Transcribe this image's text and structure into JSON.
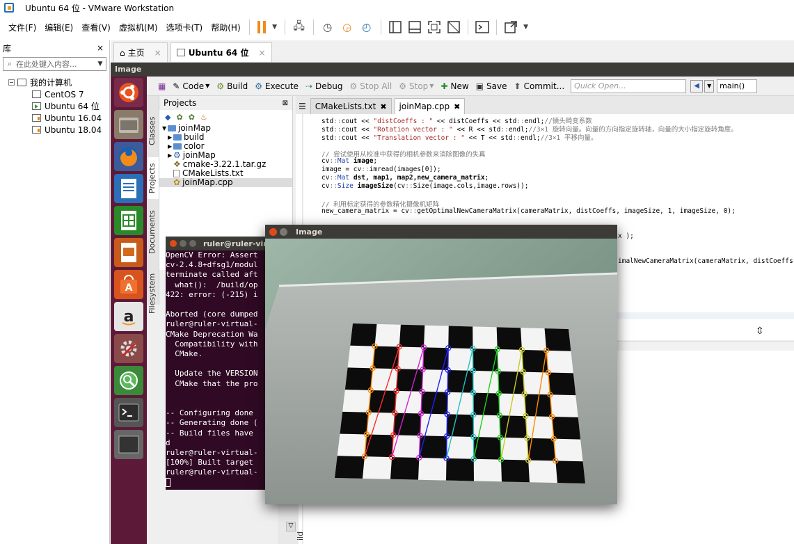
{
  "window": {
    "title": "Ubuntu 64 位 - VMware Workstation"
  },
  "menubar": {
    "items": [
      "文件(F)",
      "编辑(E)",
      "查看(V)",
      "虚拟机(M)",
      "选项卡(T)",
      "帮助(H)"
    ]
  },
  "library": {
    "title": "库",
    "close": "×",
    "search_placeholder": "在此处键入内容...",
    "root": "我的计算机",
    "vms": [
      "CentOS 7",
      "Ubuntu 64 位",
      "Ubuntu 16.04",
      "Ubuntu 18.04"
    ]
  },
  "tabs": {
    "home": "主页",
    "vm": "Ubuntu 64 位"
  },
  "guest": {
    "topbar_title": "Image",
    "ide": {
      "toolbar": {
        "code": "Code",
        "build": "Build",
        "execute": "Execute",
        "debug": "Debug",
        "stop_all": "Stop All",
        "stop": "Stop",
        "new": "New",
        "save": "Save",
        "commit": "Commit...",
        "quick_open_placeholder": "Quick Open...",
        "function": "main()"
      },
      "side_tabs": [
        "Classes",
        "Projects",
        "Documents",
        "Filesystem"
      ],
      "projects": {
        "header": "Projects",
        "tree": [
          "joinMap",
          "build",
          "color",
          "joinMap",
          "cmake-3.22.1.tar.gz",
          "CMakeLists.txt",
          "joinMap.cpp"
        ]
      },
      "editor_tabs": [
        "CMakeLists.txt",
        "joinMap.cpp"
      ],
      "code": [
        "std::cout << \"distCoeffs : \" << distCoeffs << std::endl;//镜头畸变系数",
        "std::cout << \"Rotation vector : \" << R << std::endl;//3×1 旋转向量。向量的方向指定旋转轴，向量的大小指定旋转角度。",
        "std::cout << \"Translation vector : \" << T << std::endl;//3×1 平移向量。",
        "",
        "// 尝试使用从校准中获得的相机参数来消除图像的失真",
        "cv::Mat image;",
        "image = cv::imread(images[0]);",
        "cv::Mat dst, map1, map2,new_camera_matrix;",
        "cv::Size imageSize(cv::Size(image.cols,image.rows));",
        "",
        "// 利用标定获得的参数精化摄像机矩阵",
        "new_camera_matrix = cv::getOptimalNewCameraMatrix(cameraMatrix, distCoeffs, imageSize, 1, imageSize, 0);"
      ],
      "code_partial_1": "x );",
      "code_partial_2": "imalNewCameraMatrix(cameraMatrix, distCoeffs,",
      "bottom_label_build": "Bu",
      "bottom_label_n": "N",
      "bottom_label_ild": "ild"
    },
    "terminal": {
      "title": "ruler@ruler-vir",
      "lines": [
        "OpenCV Error: Assert",
        "cv-2.4.8+dfsg1/modul",
        "terminate called aft",
        "  what():  /build/op",
        "422: error: (-215) i",
        "",
        "Aborted (core dumped",
        "ruler@ruler-virtual-",
        "CMake Deprecation Wa",
        "  Compatibility with",
        "  CMake.",
        "",
        "  Update the VERSION",
        "  CMake that the pro",
        "",
        "",
        "-- Configuring done",
        "-- Generating done (",
        "-- Build files have",
        "d",
        "ruler@ruler-virtual-",
        "[100%] Built target",
        "ruler@ruler-virtual-"
      ]
    },
    "image_window": {
      "title": "Image"
    }
  },
  "colors": {
    "launcher": "#5c1a38",
    "terminal_bg": "#300a24",
    "ubuntu_title": "#3c3b37",
    "close_dot": "#df4b16",
    "vmware_pause": "#f08a1c"
  }
}
